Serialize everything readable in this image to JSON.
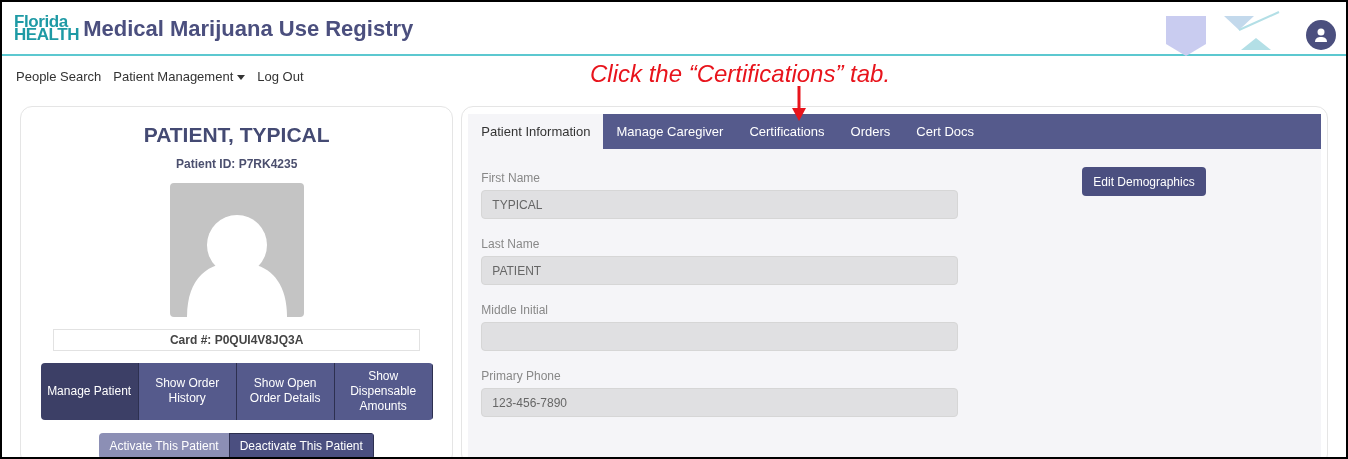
{
  "header": {
    "logo_top": "Florida",
    "logo_bottom": "HEALTH",
    "title": "Medical Marijuana Use Registry"
  },
  "nav": [
    {
      "label": "People Search",
      "kind": "link"
    },
    {
      "label": "Patient Management",
      "kind": "dropdown"
    },
    {
      "label": "Log Out",
      "kind": "link"
    }
  ],
  "annotation": {
    "text": "Click the “Certifications” tab."
  },
  "patient": {
    "name": "PATIENT, TYPICAL",
    "id": "Patient ID: P7RK4235",
    "card": "Card #: P0QUI4V8JQ3A",
    "actions": [
      {
        "label": "Manage Patient",
        "selected": true
      },
      {
        "label": "Show Order History",
        "selected": false
      },
      {
        "label": "Show Open Order Details",
        "selected": false
      },
      {
        "label": "Show Dispensable Amounts",
        "selected": false
      }
    ],
    "status_buttons": [
      {
        "label": "Activate This Patient",
        "disabled": true
      },
      {
        "label": "Deactivate This Patient",
        "disabled": false
      }
    ]
  },
  "tabs": [
    {
      "label": "Patient Information",
      "selected": true
    },
    {
      "label": "Manage Caregiver",
      "selected": false
    },
    {
      "label": "Certifications",
      "selected": false
    },
    {
      "label": "Orders",
      "selected": false
    },
    {
      "label": "Cert Docs",
      "selected": false
    }
  ],
  "form": {
    "fields": [
      {
        "label": "First Name",
        "value": "TYPICAL",
        "disabled": true
      },
      {
        "label": "Last Name",
        "value": "PATIENT",
        "disabled": true
      },
      {
        "label": "Middle Initial",
        "disabled": true
      },
      {
        "label": "Primary Phone",
        "value": "123-456-7890",
        "disabled": true
      }
    ],
    "edit_button": "Edit Demographics"
  }
}
